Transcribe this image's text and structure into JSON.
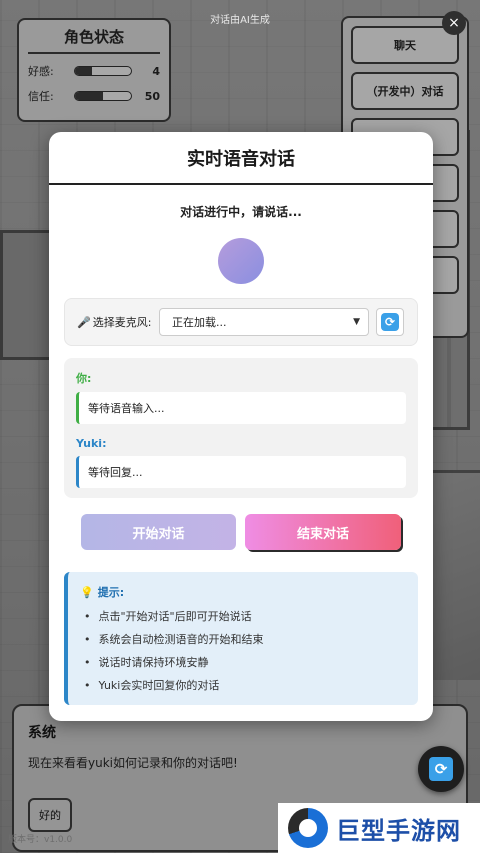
{
  "header": {
    "ai_note": "对话由AI生成",
    "version": "版本号：v1.0.0"
  },
  "status": {
    "title": "角色状态",
    "stats": [
      {
        "label": "好感:",
        "value": "4",
        "fill": 0.3
      },
      {
        "label": "信任:",
        "value": "50",
        "fill": 0.5
      }
    ]
  },
  "menu": {
    "items": [
      "聊天",
      "（开发中）对话",
      "",
      "",
      "",
      ""
    ]
  },
  "close_label": "×",
  "system": {
    "title": "系统",
    "text": "现在来看看yuki如何记录和你的对话吧!",
    "ok_label": "好的"
  },
  "voice_modal": {
    "title": "实时语音对话",
    "status_text": "对话进行中，请说话...",
    "mic_label": "选择麦克风:",
    "mic_icon": "🎤",
    "mic_value": "正在加载...",
    "refresh_icon": "⟳",
    "you_label": "你:",
    "you_text": "等待语音输入...",
    "yuki_label": "Yuki:",
    "yuki_text": "等待回复...",
    "start_label": "开始对话",
    "end_label": "结束对话",
    "tips_icon": "💡",
    "tips_title": "提示:",
    "tips": [
      "点击\"开始对话\"后即可开始说话",
      "系统会自动检测语音的开始和结束",
      "说话时请保持环境安静",
      "Yuki会实时回复你的对话"
    ]
  },
  "watermark": {
    "text": "巨型手游网"
  },
  "colors": {
    "you": "#3fae45",
    "yuki": "#2c86c8",
    "end_button": "#f0607a",
    "tips_bg": "#e3eff9"
  }
}
